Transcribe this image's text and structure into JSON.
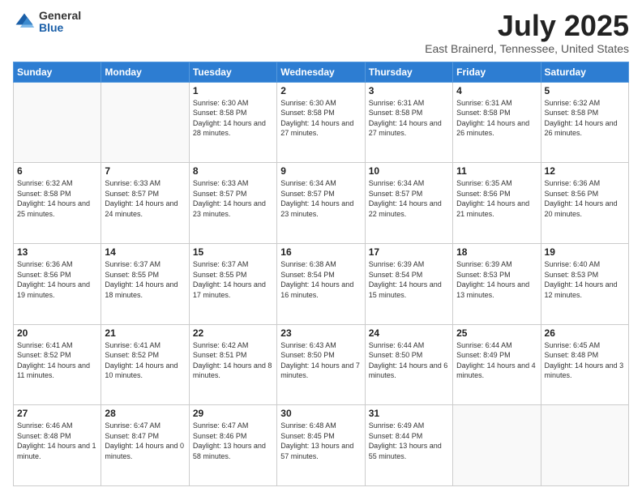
{
  "logo": {
    "general": "General",
    "blue": "Blue"
  },
  "title": "July 2025",
  "subtitle": "East Brainerd, Tennessee, United States",
  "headers": [
    "Sunday",
    "Monday",
    "Tuesday",
    "Wednesday",
    "Thursday",
    "Friday",
    "Saturday"
  ],
  "weeks": [
    [
      {
        "day": "",
        "info": ""
      },
      {
        "day": "",
        "info": ""
      },
      {
        "day": "1",
        "info": "Sunrise: 6:30 AM\nSunset: 8:58 PM\nDaylight: 14 hours and 28 minutes."
      },
      {
        "day": "2",
        "info": "Sunrise: 6:30 AM\nSunset: 8:58 PM\nDaylight: 14 hours and 27 minutes."
      },
      {
        "day": "3",
        "info": "Sunrise: 6:31 AM\nSunset: 8:58 PM\nDaylight: 14 hours and 27 minutes."
      },
      {
        "day": "4",
        "info": "Sunrise: 6:31 AM\nSunset: 8:58 PM\nDaylight: 14 hours and 26 minutes."
      },
      {
        "day": "5",
        "info": "Sunrise: 6:32 AM\nSunset: 8:58 PM\nDaylight: 14 hours and 26 minutes."
      }
    ],
    [
      {
        "day": "6",
        "info": "Sunrise: 6:32 AM\nSunset: 8:58 PM\nDaylight: 14 hours and 25 minutes."
      },
      {
        "day": "7",
        "info": "Sunrise: 6:33 AM\nSunset: 8:57 PM\nDaylight: 14 hours and 24 minutes."
      },
      {
        "day": "8",
        "info": "Sunrise: 6:33 AM\nSunset: 8:57 PM\nDaylight: 14 hours and 23 minutes."
      },
      {
        "day": "9",
        "info": "Sunrise: 6:34 AM\nSunset: 8:57 PM\nDaylight: 14 hours and 23 minutes."
      },
      {
        "day": "10",
        "info": "Sunrise: 6:34 AM\nSunset: 8:57 PM\nDaylight: 14 hours and 22 minutes."
      },
      {
        "day": "11",
        "info": "Sunrise: 6:35 AM\nSunset: 8:56 PM\nDaylight: 14 hours and 21 minutes."
      },
      {
        "day": "12",
        "info": "Sunrise: 6:36 AM\nSunset: 8:56 PM\nDaylight: 14 hours and 20 minutes."
      }
    ],
    [
      {
        "day": "13",
        "info": "Sunrise: 6:36 AM\nSunset: 8:56 PM\nDaylight: 14 hours and 19 minutes."
      },
      {
        "day": "14",
        "info": "Sunrise: 6:37 AM\nSunset: 8:55 PM\nDaylight: 14 hours and 18 minutes."
      },
      {
        "day": "15",
        "info": "Sunrise: 6:37 AM\nSunset: 8:55 PM\nDaylight: 14 hours and 17 minutes."
      },
      {
        "day": "16",
        "info": "Sunrise: 6:38 AM\nSunset: 8:54 PM\nDaylight: 14 hours and 16 minutes."
      },
      {
        "day": "17",
        "info": "Sunrise: 6:39 AM\nSunset: 8:54 PM\nDaylight: 14 hours and 15 minutes."
      },
      {
        "day": "18",
        "info": "Sunrise: 6:39 AM\nSunset: 8:53 PM\nDaylight: 14 hours and 13 minutes."
      },
      {
        "day": "19",
        "info": "Sunrise: 6:40 AM\nSunset: 8:53 PM\nDaylight: 14 hours and 12 minutes."
      }
    ],
    [
      {
        "day": "20",
        "info": "Sunrise: 6:41 AM\nSunset: 8:52 PM\nDaylight: 14 hours and 11 minutes."
      },
      {
        "day": "21",
        "info": "Sunrise: 6:41 AM\nSunset: 8:52 PM\nDaylight: 14 hours and 10 minutes."
      },
      {
        "day": "22",
        "info": "Sunrise: 6:42 AM\nSunset: 8:51 PM\nDaylight: 14 hours and 8 minutes."
      },
      {
        "day": "23",
        "info": "Sunrise: 6:43 AM\nSunset: 8:50 PM\nDaylight: 14 hours and 7 minutes."
      },
      {
        "day": "24",
        "info": "Sunrise: 6:44 AM\nSunset: 8:50 PM\nDaylight: 14 hours and 6 minutes."
      },
      {
        "day": "25",
        "info": "Sunrise: 6:44 AM\nSunset: 8:49 PM\nDaylight: 14 hours and 4 minutes."
      },
      {
        "day": "26",
        "info": "Sunrise: 6:45 AM\nSunset: 8:48 PM\nDaylight: 14 hours and 3 minutes."
      }
    ],
    [
      {
        "day": "27",
        "info": "Sunrise: 6:46 AM\nSunset: 8:48 PM\nDaylight: 14 hours and 1 minute."
      },
      {
        "day": "28",
        "info": "Sunrise: 6:47 AM\nSunset: 8:47 PM\nDaylight: 14 hours and 0 minutes."
      },
      {
        "day": "29",
        "info": "Sunrise: 6:47 AM\nSunset: 8:46 PM\nDaylight: 13 hours and 58 minutes."
      },
      {
        "day": "30",
        "info": "Sunrise: 6:48 AM\nSunset: 8:45 PM\nDaylight: 13 hours and 57 minutes."
      },
      {
        "day": "31",
        "info": "Sunrise: 6:49 AM\nSunset: 8:44 PM\nDaylight: 13 hours and 55 minutes."
      },
      {
        "day": "",
        "info": ""
      },
      {
        "day": "",
        "info": ""
      }
    ]
  ]
}
